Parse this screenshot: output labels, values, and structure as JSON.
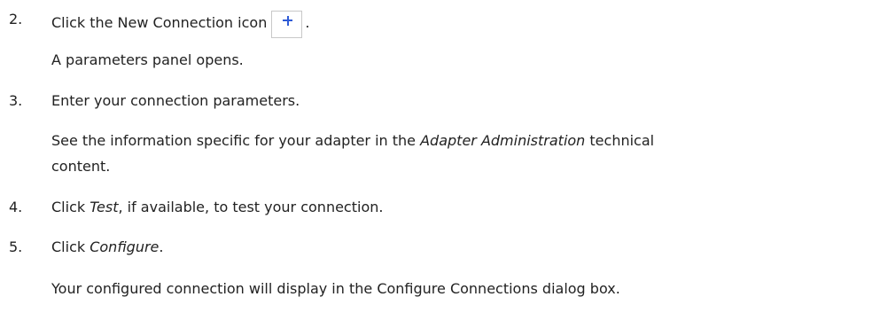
{
  "steps": [
    {
      "number": "2.",
      "text_before_icon": "Click the New Connection icon",
      "icon": "plus-icon",
      "text_after_icon": ".",
      "note": "A parameters panel opens."
    },
    {
      "number": "3.",
      "text": "Enter your connection parameters.",
      "note_part1": "See the information specific for your adapter in the ",
      "note_italic": "Adapter Administration",
      "note_part2": " technical",
      "note_line2": "content."
    },
    {
      "number": "4.",
      "text_part1": "Click ",
      "text_italic": "Test",
      "text_part2": ", if available, to test your connection."
    },
    {
      "number": "5.",
      "text_part1": "Click ",
      "text_italic": "Configure",
      "text_part2": ".",
      "note": "Your configured connection will display in the Configure Connections dialog box."
    }
  ],
  "colors": {
    "text": "#222222",
    "icon_plus": "#2f5bd6",
    "icon_border": "#c8c8c8"
  }
}
